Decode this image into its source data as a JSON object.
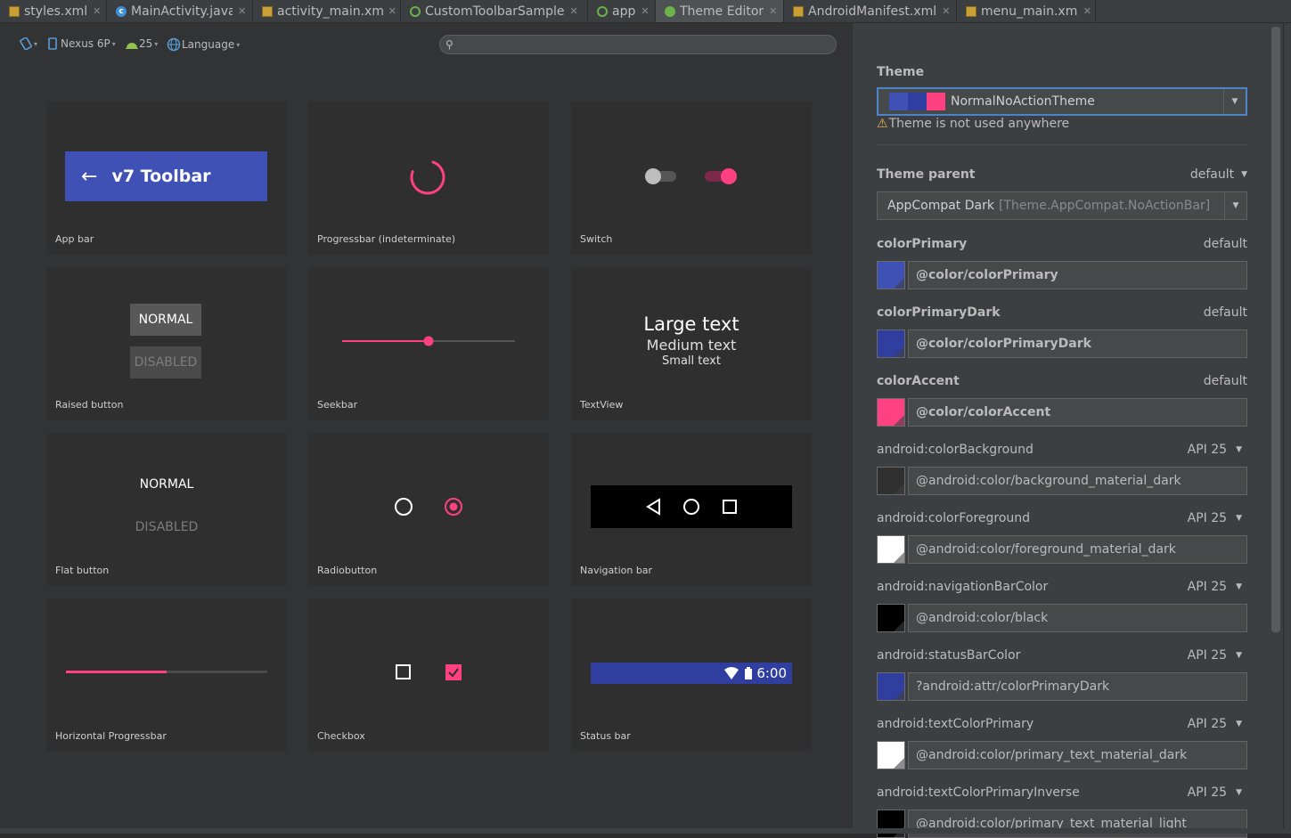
{
  "tabs": [
    {
      "label": "styles.xml",
      "icon": "xml-file-icon"
    },
    {
      "label": "MainActivity.java",
      "icon": "java-class-icon"
    },
    {
      "label": "activity_main.xml",
      "icon": "xml-file-icon"
    },
    {
      "label": "CustomToolbarSample",
      "icon": "module-icon"
    },
    {
      "label": "app",
      "icon": "module-icon"
    },
    {
      "label": "Theme Editor",
      "icon": "theme-editor-icon"
    },
    {
      "label": "AndroidManifest.xml",
      "icon": "xml-file-icon"
    },
    {
      "label": "menu_main.xml",
      "icon": "xml-file-icon"
    }
  ],
  "preview_toolbar": {
    "device": "Nexus 6P",
    "api": "25",
    "language": "Language",
    "search_placeholder": ""
  },
  "cards": {
    "app_bar": {
      "label": "App bar",
      "toolbar_title": "v7 Toolbar"
    },
    "progressbar": {
      "label": "Progressbar (indeterminate)"
    },
    "switch": {
      "label": "Switch"
    },
    "raised_button": {
      "label": "Raised button",
      "normal": "NORMAL",
      "disabled": "DISABLED"
    },
    "seekbar": {
      "label": "Seekbar",
      "level": 0.5
    },
    "textview": {
      "label": "TextView",
      "large": "Large text",
      "medium": "Medium text",
      "small": "Small text"
    },
    "flat_button": {
      "label": "Flat button",
      "normal": "NORMAL",
      "disabled": "DISABLED"
    },
    "radiobutton": {
      "label": "Radiobutton"
    },
    "navigation_bar": {
      "label": "Navigation bar"
    },
    "horizontal_progressbar": {
      "label": "Horizontal Progressbar",
      "level": 0.5
    },
    "checkbox": {
      "label": "Checkbox"
    },
    "status_bar": {
      "label": "Status bar",
      "time": "6:00"
    }
  },
  "panel": {
    "theme_label": "Theme",
    "theme_value": "NormalNoActionTheme",
    "theme_warning": "Theme is not used anywhere",
    "theme_parent_label": "Theme parent",
    "theme_parent_default": "default",
    "theme_parent_value": "AppCompat Dark",
    "theme_parent_hint": "[Theme.AppCompat.NoActionBar]",
    "attributes": [
      {
        "name": "colorPrimary",
        "scope": "default",
        "value": "@color/colorPrimary",
        "color": "#3f51b5",
        "bold": true,
        "has_caret": false
      },
      {
        "name": "colorPrimaryDark",
        "scope": "default",
        "value": "@color/colorPrimaryDark",
        "color": "#303f9f",
        "bold": true,
        "has_caret": false
      },
      {
        "name": "colorAccent",
        "scope": "default",
        "value": "@color/colorAccent",
        "color": "#ff4081",
        "bold": true,
        "has_caret": false
      },
      {
        "name": "android:colorBackground",
        "scope": "API 25",
        "value": "@android:color/background_material_dark",
        "color": "#303030",
        "bold": false,
        "has_caret": true
      },
      {
        "name": "android:colorForeground",
        "scope": "API 25",
        "value": "@android:color/foreground_material_dark",
        "color": "#ffffff",
        "bold": false,
        "has_caret": true
      },
      {
        "name": "android:navigationBarColor",
        "scope": "API 25",
        "value": "@android:color/black",
        "color": "#000000",
        "bold": false,
        "has_caret": true
      },
      {
        "name": "android:statusBarColor",
        "scope": "API 25",
        "value": "?android:attr/colorPrimaryDark",
        "color": "#303f9f",
        "bold": false,
        "has_caret": true
      },
      {
        "name": "android:textColorPrimary",
        "scope": "API 25",
        "value": "@android:color/primary_text_material_dark",
        "color": "#ffffff",
        "bold": false,
        "has_caret": true
      },
      {
        "name": "android:textColorPrimaryInverse",
        "scope": "API 25",
        "value": "@android:color/primary_text_material_light",
        "color": "#000000",
        "bold": false,
        "has_caret": true
      }
    ]
  },
  "colors": {
    "primary": "#3f51b5",
    "primary_dark": "#303f9f",
    "accent": "#ff4081",
    "focus": "#4c84c7"
  }
}
